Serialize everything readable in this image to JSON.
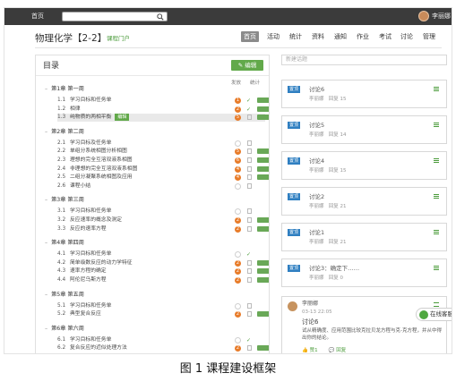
{
  "topbar": {
    "home": "首页",
    "user": "李丽娜"
  },
  "course": {
    "title": "物理化学【2-2】",
    "portal": "课程门户"
  },
  "nav": [
    "首页",
    "活动",
    "统计",
    "资料",
    "通知",
    "作业",
    "考试",
    "讨论",
    "管理"
  ],
  "toc": {
    "title": "目录",
    "edit": "编辑",
    "col_submit": "发放",
    "col_stat": "统计",
    "chapters": [
      {
        "label": "第1章 第一周",
        "lessons": [
          {
            "num": "1.1",
            "label": "学习目标和任务单",
            "status": "orange",
            "badge": "1",
            "check": true
          },
          {
            "num": "1.2",
            "label": "相律",
            "status": "orange",
            "badge": "2",
            "check": true
          },
          {
            "num": "1.3",
            "label": "纯物质的两相平衡",
            "tag": "编辑",
            "status": "orange",
            "badge": "5",
            "check": false,
            "selected": true
          }
        ]
      },
      {
        "label": "第2章 第二周",
        "lessons": [
          {
            "num": "2.1",
            "label": "学习目标及任务单",
            "status": "empty",
            "check": false
          },
          {
            "num": "2.2",
            "label": "单组分系统相图分析相图",
            "status": "orange",
            "badge": "5",
            "check": false
          },
          {
            "num": "2.3",
            "label": "理想的完全互溶双液系相图",
            "status": "orange",
            "badge": "6",
            "check": false
          },
          {
            "num": "2.4",
            "label": "非理想的完全互溶双液系相图",
            "status": "orange",
            "badge": "4",
            "check": false
          },
          {
            "num": "2.5",
            "label": "二组分凝聚系统相图及应用",
            "status": "orange",
            "badge": "4",
            "check": false
          },
          {
            "num": "2.6",
            "label": "课程小结",
            "status": "empty",
            "check": false
          }
        ]
      },
      {
        "label": "第3章 第三周",
        "lessons": [
          {
            "num": "3.1",
            "label": "学习目标和任务单",
            "status": "empty",
            "check": false
          },
          {
            "num": "3.2",
            "label": "反应速率的概念及测定",
            "status": "orange",
            "badge": "2",
            "check": false
          },
          {
            "num": "3.3",
            "label": "反应的速率方程",
            "status": "orange",
            "badge": "2",
            "check": false
          }
        ]
      },
      {
        "label": "第4章 第四周",
        "lessons": [
          {
            "num": "4.1",
            "label": "学习目标和任务单",
            "status": "empty",
            "check": true
          },
          {
            "num": "4.2",
            "label": "简单级数反应的动力学特征",
            "status": "orange",
            "badge": "2",
            "check": false
          },
          {
            "num": "4.3",
            "label": "速率方程的确定",
            "status": "orange",
            "badge": "2",
            "check": false
          },
          {
            "num": "4.4",
            "label": "阿伦尼乌斯方程",
            "status": "orange",
            "badge": "2",
            "check": false
          }
        ]
      },
      {
        "label": "第5章 第五周",
        "lessons": [
          {
            "num": "5.1",
            "label": "学习目标和任务单",
            "status": "empty",
            "check": false
          },
          {
            "num": "5.2",
            "label": "典型复合反应",
            "status": "orange",
            "badge": "2",
            "check": false
          }
        ]
      },
      {
        "label": "第6章 第六周",
        "lessons": [
          {
            "num": "6.1",
            "label": "学习目标和任务单",
            "status": "empty",
            "check": true
          },
          {
            "num": "6.2",
            "label": "复合反应的近似处理方法",
            "status": "orange",
            "badge": "2",
            "check": false
          }
        ]
      }
    ]
  },
  "topics": {
    "search_placeholder": "新建话题",
    "cards": [
      {
        "badge": "置顶",
        "title": "讨论6",
        "author": "李丽娜",
        "replies": "回复 15"
      },
      {
        "badge": "置顶",
        "title": "讨论5",
        "author": "李丽娜",
        "replies": "回复 14"
      },
      {
        "badge": "置顶",
        "title": "讨论4",
        "author": "李丽娜",
        "replies": "回复 15"
      },
      {
        "badge": "置顶",
        "title": "讨论2",
        "author": "李丽娜",
        "replies": "回复 21"
      },
      {
        "badge": "置顶",
        "title": "讨论1",
        "author": "李丽娜",
        "replies": "回复 21"
      },
      {
        "badge": "置顶",
        "title": "讨论3：确定下……",
        "author": "李丽娜",
        "replies": "回复 0"
      }
    ],
    "post": {
      "author": "李丽娜",
      "date": "03-13 22:05",
      "title": "讨论6",
      "body": "试从精确度、应用范围比较克拉贝龙方程与克-克方程，并从中得出你的结论。",
      "like": "赞1",
      "reply": "回复"
    }
  },
  "online_chat": "在线客服",
  "caption": "图 1  课程建设框架",
  "colors": {
    "accent_green": "#62a94a",
    "badge_blue": "#2f7fc1",
    "orange": "#e87c2a",
    "topbar": "#3b3b3b"
  }
}
